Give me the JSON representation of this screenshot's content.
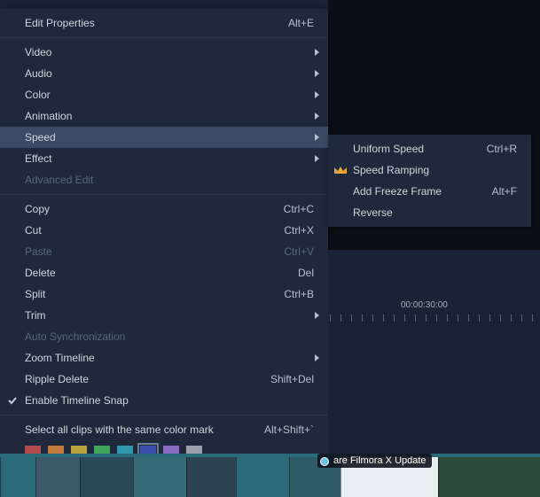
{
  "menu": {
    "edit_properties": "Edit Properties",
    "edit_properties_sc": "Alt+E",
    "video": "Video",
    "audio": "Audio",
    "color": "Color",
    "animation": "Animation",
    "speed": "Speed",
    "effect": "Effect",
    "advanced_edit": "Advanced Edit",
    "copy": "Copy",
    "copy_sc": "Ctrl+C",
    "cut": "Cut",
    "cut_sc": "Ctrl+X",
    "paste": "Paste",
    "paste_sc": "Ctrl+V",
    "delete": "Delete",
    "delete_sc": "Del",
    "split": "Split",
    "split_sc": "Ctrl+B",
    "trim": "Trim",
    "auto_sync": "Auto Synchronization",
    "zoom_timeline": "Zoom Timeline",
    "ripple_delete": "Ripple Delete",
    "ripple_delete_sc": "Shift+Del",
    "enable_snap": "Enable Timeline Snap",
    "select_all_color": "Select all clips with the same color mark",
    "select_all_color_sc": "Alt+Shift+`"
  },
  "submenu": {
    "uniform": "Uniform Speed",
    "uniform_sc": "Ctrl+R",
    "ramping": "Speed Ramping",
    "freeze": "Add Freeze Frame",
    "freeze_sc": "Alt+F",
    "reverse": "Reverse"
  },
  "timeline": {
    "timecode": "00:00:30:00"
  },
  "colors": [
    "#b24b4b",
    "#c07a3e",
    "#b8a33e",
    "#3fa55a",
    "#2f98ad",
    "#3a4fae",
    "#8a6bc2",
    "#9aa0ab"
  ],
  "selected_color_index": 5,
  "popup": {
    "label": "are Filmora X Update"
  },
  "thumbs": [
    {
      "w": 40,
      "bg": "#2a6b7a"
    },
    {
      "w": 50,
      "bg": "#3a5a6a"
    },
    {
      "w": 60,
      "bg": "#284a58"
    },
    {
      "w": 60,
      "bg": "#356a78"
    },
    {
      "w": 56,
      "bg": "#2d4450"
    },
    {
      "w": 60,
      "bg": "#2a6b7a"
    },
    {
      "w": 58,
      "bg": "#2f5b68"
    },
    {
      "w": 110,
      "bg": "#e9eef3"
    },
    {
      "w": 115,
      "bg": "#2b4a37"
    }
  ]
}
